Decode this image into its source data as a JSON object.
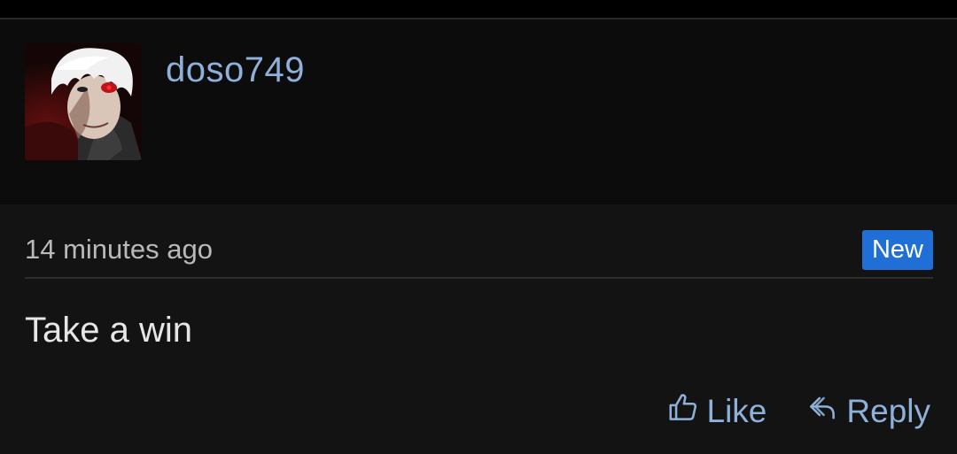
{
  "post": {
    "username": "doso749",
    "timestamp": "14 minutes ago",
    "badge": "New",
    "message": "Take a win"
  },
  "actions": {
    "like_label": "Like",
    "reply_label": "Reply"
  },
  "icons": {
    "like": "thumbs-up-icon",
    "reply": "reply-arrow-icon"
  },
  "colors": {
    "link": "#8fb0d8",
    "badge": "#1f6fd6",
    "background": "#131313",
    "header_background": "#0c0c0c"
  }
}
